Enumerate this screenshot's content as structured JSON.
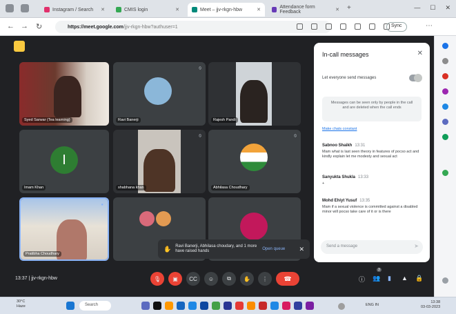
{
  "browser": {
    "tabs": [
      {
        "title": "Instagram / Search",
        "color": "#e1306c"
      },
      {
        "title": "CMIS login",
        "color": "#34a853"
      },
      {
        "title": "Meet – jjv-rkgn-hbw",
        "color": "#00897b"
      },
      {
        "title": "Attendance form Feedback",
        "color": "#673ab7"
      }
    ],
    "url_host": "https://meet.google.com",
    "url_path": "/jjv-rkgn-hbw?authuser=1",
    "sync_label": "Sync"
  },
  "meet": {
    "participants": [
      {
        "name": "Syed Sarwar (Tea learning)",
        "kind": "video",
        "bg": "#6b3a2e",
        "skin": "#4a2a22"
      },
      {
        "name": "Ravi Banerji",
        "kind": "avatar",
        "bg": "#3c4043",
        "avatar_color": "#8bb7d9"
      },
      {
        "name": "Rajesh Pandi",
        "kind": "video",
        "bg": "#cfd4d8",
        "skin": "#3b2b24"
      },
      {
        "name": "Imam Khan",
        "kind": "letter",
        "bg": "#3c4043",
        "avatar_color": "#2e7d32",
        "letter": "I"
      },
      {
        "name": "shabhana khan",
        "kind": "video",
        "bg": "#c9c4bd",
        "skin": "#4e3426"
      },
      {
        "name": "Abhilasa Choudhary",
        "kind": "avatar",
        "bg": "#3c4043",
        "avatar_color": "#f2a33a"
      },
      {
        "name": "Pratibha Choudhary",
        "kind": "video",
        "bg": "#a9c5e8",
        "skin": "#b0786a"
      },
      {
        "name": "",
        "kind": "avatar",
        "bg": "#3c4043",
        "avatar_color": "#d96a7a"
      },
      {
        "name": "",
        "kind": "avatar",
        "bg": "#3c4043",
        "avatar_color": "#c2185b"
      }
    ],
    "notification": {
      "text": "Ravi Banerji, Abhilasa choudary, and 1 more have raised hands",
      "action": "Open queue"
    },
    "time": "13:37",
    "meeting_code": "jjv-rkgn-hbw",
    "controls": [
      "mic-off",
      "camera-off",
      "captions",
      "emoji",
      "present",
      "raise-hand",
      "more"
    ],
    "raised_hands_count": "3"
  },
  "chat": {
    "title": "In-call messages",
    "toggle_label": "Let everyone send messages",
    "info": "Messages can be seen only by people in the call and are deleted when the call ends",
    "link": "Make chats constant",
    "messages": [
      {
        "sender": "Sabnoo Shaikh",
        "time": "13:31",
        "text": "Mam what is last seen theory in features of pocso act and kindly explain let me modesty and sexual act"
      },
      {
        "sender": "Sanyukta Shukla",
        "time": "13:33",
        "text": "+"
      },
      {
        "sender": "Mohd Ehiyt Yusuf",
        "time": "13:35",
        "text": "Mam if a sexual violence is committed against a disabled minor will pocso take care of it or is there"
      }
    ],
    "input_placeholder": "Send a message"
  },
  "taskbar": {
    "weather_temp": "30°C",
    "weather_desc": "Haze",
    "search_label": "Search",
    "clock_time": "13:38",
    "clock_date": "03-03-2023",
    "lang": "ENG IN"
  }
}
